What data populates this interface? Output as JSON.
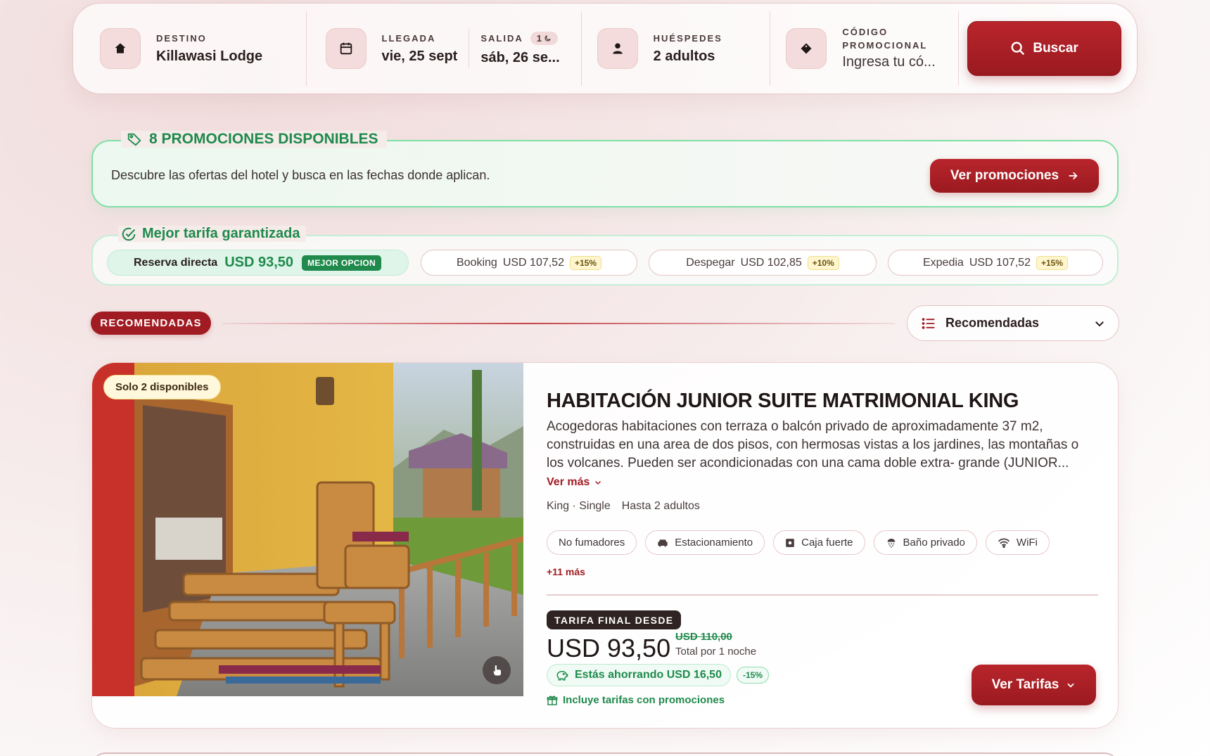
{
  "search": {
    "destination": {
      "label": "DESTINO",
      "value": "Killawasi Lodge"
    },
    "checkin": {
      "label": "LLEGADA",
      "value": "vie, 25 sept"
    },
    "checkout": {
      "label": "SALIDA",
      "value": "sáb, 26 se...",
      "nights": "1"
    },
    "guests": {
      "label": "HUÉSPEDES",
      "value": "2 adultos"
    },
    "promo_code": {
      "label_line1": "CÓDIGO",
      "label_line2": "PROMOCIONAL",
      "placeholder": "Ingresa tu có..."
    },
    "search_button": "Buscar"
  },
  "promotions": {
    "title": "8 PROMOCIONES DISPONIBLES",
    "description": "Descubre las ofertas del hotel y busca en las fechas donde aplican.",
    "button": "Ver promociones"
  },
  "best_rate": {
    "title": "Mejor tarifa garantizada",
    "direct": {
      "name": "Reserva directa",
      "price": "USD 93,50",
      "badge": "MEJOR OPCION"
    },
    "competitors": [
      {
        "name": "Booking",
        "price": "USD 107,52",
        "diff": "+15%"
      },
      {
        "name": "Despegar",
        "price": "USD 102,85",
        "diff": "+10%"
      },
      {
        "name": "Expedia",
        "price": "USD 107,52",
        "diff": "+15%"
      }
    ]
  },
  "section": {
    "badge": "RECOMENDADAS",
    "sort_value": "Recomendadas"
  },
  "room": {
    "availability": "Solo 2 disponibles",
    "name": "HABITACIÓN JUNIOR SUITE MATRIMONIAL KING",
    "description": "Acogedoras habitaciones con terraza o balcón privado de aproximadamente 37 m2, construidas en una area de dos pisos, con hermosas vistas a los jardines, las montañas o los volcanes. Pueden ser acondicionadas con una cama doble extra- grande (JUNIOR...",
    "see_more": "Ver más",
    "beds": "King · Single",
    "capacity": "Hasta 2 adultos",
    "amenities": [
      "No fumadores",
      "Estacionamiento",
      "Caja fuerte",
      "Baño privado",
      "WiFi"
    ],
    "more_amenities": "+11 más",
    "rate_label": "TARIFA FINAL DESDE",
    "price": "USD 93,50",
    "old_price": "USD 110,00",
    "per_night": "Total por 1 noche",
    "savings": "Estás ahorrando USD 16,50",
    "savings_pct": "-15%",
    "includes_promos": "Incluye tarifas con promociones",
    "rates_button": "Ver Tarifas"
  },
  "colors": {
    "brand_red": "#a11c22",
    "success_green": "#1f8a4c",
    "promo_border": "#7fe0a6"
  }
}
